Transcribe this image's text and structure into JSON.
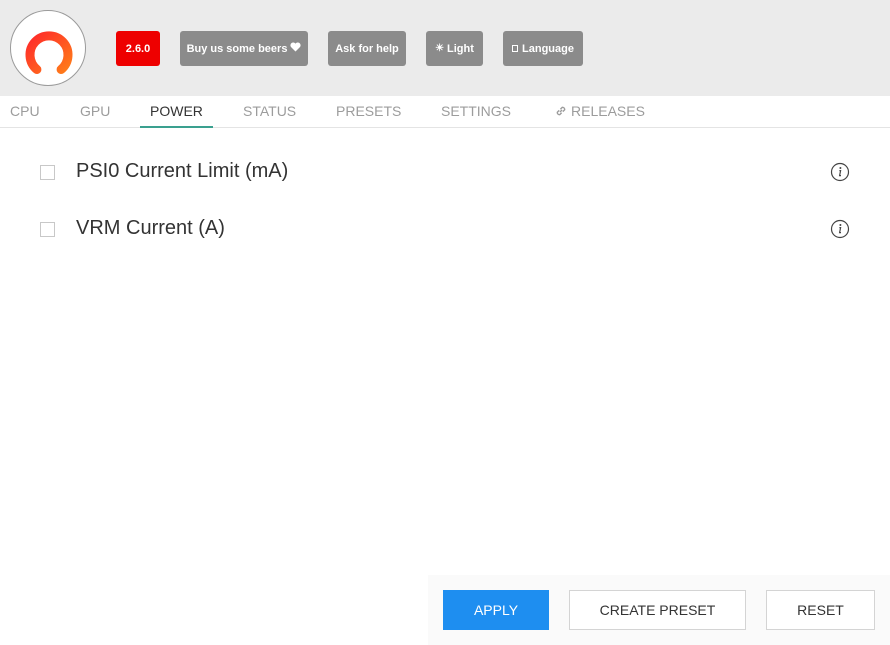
{
  "header": {
    "logo_icon": "app-logo-icon",
    "version_label": "2.6.0",
    "beers_label": "Buy us some beers",
    "beers_icon": "heart-icon",
    "help_label": "Ask for help",
    "light_label": "Light",
    "light_icon": "sun-icon",
    "language_label": "Language",
    "language_icon": "square-icon",
    "colors": {
      "background": "#ebebeb",
      "version_badge": "#ee0000",
      "button": "#8b8b8b"
    }
  },
  "tabs": [
    {
      "label": "CPU"
    },
    {
      "label": "GPU"
    },
    {
      "label": "POWER",
      "active": true
    },
    {
      "label": "STATUS"
    },
    {
      "label": "PRESETS"
    },
    {
      "label": "SETTINGS"
    },
    {
      "label": "RELEASES",
      "icon": "link-icon"
    }
  ],
  "power": {
    "items": [
      {
        "label": "PSI0 Current Limit (mA)",
        "checked": false,
        "icon": "info-icon"
      },
      {
        "label": "VRM Current (A)",
        "checked": false,
        "icon": "info-icon"
      }
    ]
  },
  "footer": {
    "apply_label": "APPLY",
    "create_preset_label": "CREATE PRESET",
    "reset_label": "RESET",
    "colors": {
      "apply": "#1e8ef0",
      "active_tab": "#3aa08f"
    }
  }
}
